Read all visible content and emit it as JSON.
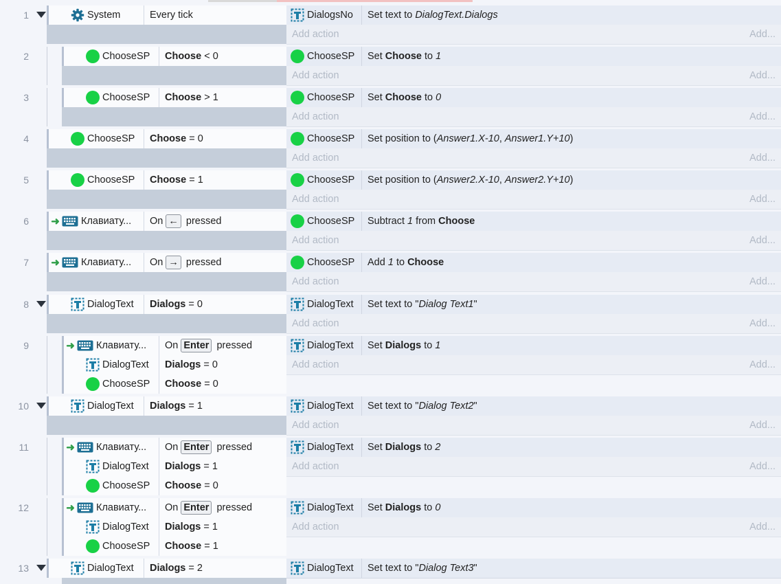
{
  "labels": {
    "add_action": "Add action",
    "add": "Add...",
    "on": "On",
    "pressed": "pressed"
  },
  "colors": {
    "sprite_dot": "#18d146",
    "text_icon": "#1d7ea6",
    "keyboard_icon": "#1d6f94",
    "arrow": "#2e9e48"
  },
  "events": [
    {
      "num": "1",
      "collapse": true,
      "conditions": [
        {
          "icon": "gear-icon",
          "object": "System",
          "parts": [
            {
              "t": "Every tick",
              "s": "n"
            }
          ]
        }
      ],
      "actions": [
        {
          "icon": "text-icon",
          "object": "DialogsNo",
          "parts": [
            {
              "t": "Set text to ",
              "s": "n"
            },
            {
              "t": "DialogText.Dialogs",
              "s": "i"
            }
          ]
        }
      ],
      "add_row": true
    },
    {
      "num": "2",
      "sub": true,
      "conditions": [
        {
          "icon": "sprite-dot-icon",
          "object": "ChooseSP",
          "parts": [
            {
              "t": "Choose",
              "s": "b"
            },
            {
              "t": " < 0",
              "s": "n"
            }
          ]
        }
      ],
      "actions": [
        {
          "icon": "sprite-dot-icon",
          "object": "ChooseSP",
          "parts": [
            {
              "t": "Set ",
              "s": "n"
            },
            {
              "t": "Choose",
              "s": "b"
            },
            {
              "t": " to ",
              "s": "n"
            },
            {
              "t": "1",
              "s": "i"
            }
          ]
        }
      ],
      "add_row": true
    },
    {
      "num": "3",
      "sub": true,
      "conditions": [
        {
          "icon": "sprite-dot-icon",
          "object": "ChooseSP",
          "parts": [
            {
              "t": "Choose",
              "s": "b"
            },
            {
              "t": " > 1",
              "s": "n"
            }
          ]
        }
      ],
      "actions": [
        {
          "icon": "sprite-dot-icon",
          "object": "ChooseSP",
          "parts": [
            {
              "t": "Set ",
              "s": "n"
            },
            {
              "t": "Choose",
              "s": "b"
            },
            {
              "t": " to ",
              "s": "n"
            },
            {
              "t": "0",
              "s": "i"
            }
          ]
        }
      ],
      "add_row": true
    },
    {
      "num": "4",
      "conditions": [
        {
          "icon": "sprite-dot-icon",
          "object": "ChooseSP",
          "parts": [
            {
              "t": "Choose",
              "s": "b"
            },
            {
              "t": " = 0",
              "s": "n"
            }
          ]
        }
      ],
      "actions": [
        {
          "icon": "sprite-dot-icon",
          "object": "ChooseSP",
          "parts": [
            {
              "t": "Set position to (",
              "s": "n"
            },
            {
              "t": "Answer1.X-10",
              "s": "i"
            },
            {
              "t": ", ",
              "s": "n"
            },
            {
              "t": "Answer1.Y+10",
              "s": "i"
            },
            {
              "t": ")",
              "s": "n"
            }
          ]
        }
      ],
      "add_row": true
    },
    {
      "num": "5",
      "conditions": [
        {
          "icon": "sprite-dot-icon",
          "object": "ChooseSP",
          "parts": [
            {
              "t": "Choose",
              "s": "b"
            },
            {
              "t": " = 1",
              "s": "n"
            }
          ]
        }
      ],
      "actions": [
        {
          "icon": "sprite-dot-icon",
          "object": "ChooseSP",
          "parts": [
            {
              "t": "Set position to (",
              "s": "n"
            },
            {
              "t": "Answer2.X-10",
              "s": "i"
            },
            {
              "t": ", ",
              "s": "n"
            },
            {
              "t": "Answer2.Y+10",
              "s": "i"
            },
            {
              "t": ")",
              "s": "n"
            }
          ]
        }
      ],
      "add_row": true
    },
    {
      "num": "6",
      "conditions": [
        {
          "trigger": true,
          "icon": "keyboard-icon",
          "object": "Клавиату...",
          "parts": [
            {
              "t": "On ",
              "s": "n"
            },
            {
              "t": "←",
              "s": "k"
            },
            {
              "t": " pressed",
              "s": "n"
            }
          ]
        }
      ],
      "actions": [
        {
          "icon": "sprite-dot-icon",
          "object": "ChooseSP",
          "parts": [
            {
              "t": "Subtract ",
              "s": "n"
            },
            {
              "t": "1",
              "s": "i"
            },
            {
              "t": " from ",
              "s": "n"
            },
            {
              "t": "Choose",
              "s": "b"
            }
          ]
        }
      ],
      "add_row": true
    },
    {
      "num": "7",
      "conditions": [
        {
          "trigger": true,
          "icon": "keyboard-icon",
          "object": "Клавиату...",
          "parts": [
            {
              "t": "On ",
              "s": "n"
            },
            {
              "t": "→",
              "s": "k"
            },
            {
              "t": " pressed",
              "s": "n"
            }
          ]
        }
      ],
      "actions": [
        {
          "icon": "sprite-dot-icon",
          "object": "ChooseSP",
          "parts": [
            {
              "t": "Add ",
              "s": "n"
            },
            {
              "t": "1",
              "s": "i"
            },
            {
              "t": " to ",
              "s": "n"
            },
            {
              "t": "Choose",
              "s": "b"
            }
          ]
        }
      ],
      "add_row": true
    },
    {
      "num": "8",
      "collapse": true,
      "conditions": [
        {
          "icon": "text-icon",
          "object": "DialogText",
          "parts": [
            {
              "t": "Dialogs",
              "s": "b"
            },
            {
              "t": " = 0",
              "s": "n"
            }
          ]
        }
      ],
      "actions": [
        {
          "icon": "text-icon",
          "object": "DialogText",
          "parts": [
            {
              "t": "Set text to \"",
              "s": "n"
            },
            {
              "t": "Dialog Text1",
              "s": "i"
            },
            {
              "t": "\"",
              "s": "n"
            }
          ]
        }
      ],
      "add_row": true
    },
    {
      "num": "9",
      "sub": true,
      "conditions": [
        {
          "trigger": true,
          "icon": "keyboard-icon",
          "object": "Клавиату...",
          "parts": [
            {
              "t": "On ",
              "s": "n"
            },
            {
              "t": "Enter",
              "s": "k"
            },
            {
              "t": " pressed",
              "s": "n"
            }
          ]
        },
        {
          "icon": "text-icon",
          "object": "DialogText",
          "parts": [
            {
              "t": "Dialogs",
              "s": "b"
            },
            {
              "t": " = 0",
              "s": "n"
            }
          ]
        },
        {
          "icon": "sprite-dot-icon",
          "object": "ChooseSP",
          "parts": [
            {
              "t": "Choose",
              "s": "b"
            },
            {
              "t": " = 0",
              "s": "n"
            }
          ]
        }
      ],
      "actions": [
        {
          "icon": "text-icon",
          "object": "DialogText",
          "parts": [
            {
              "t": "Set ",
              "s": "n"
            },
            {
              "t": "Dialogs",
              "s": "b"
            },
            {
              "t": " to ",
              "s": "n"
            },
            {
              "t": "1",
              "s": "i"
            }
          ]
        }
      ],
      "add_row": true
    },
    {
      "num": "10",
      "collapse": true,
      "conditions": [
        {
          "icon": "text-icon",
          "object": "DialogText",
          "parts": [
            {
              "t": "Dialogs",
              "s": "b"
            },
            {
              "t": " = 1",
              "s": "n"
            }
          ]
        }
      ],
      "actions": [
        {
          "icon": "text-icon",
          "object": "DialogText",
          "parts": [
            {
              "t": "Set text to \"",
              "s": "n"
            },
            {
              "t": "Dialog Text2",
              "s": "i"
            },
            {
              "t": "\"",
              "s": "n"
            }
          ]
        }
      ],
      "add_row": true
    },
    {
      "num": "11",
      "sub": true,
      "conditions": [
        {
          "trigger": true,
          "icon": "keyboard-icon",
          "object": "Клавиату...",
          "parts": [
            {
              "t": "On ",
              "s": "n"
            },
            {
              "t": "Enter",
              "s": "k"
            },
            {
              "t": " pressed",
              "s": "n"
            }
          ]
        },
        {
          "icon": "text-icon",
          "object": "DialogText",
          "parts": [
            {
              "t": "Dialogs",
              "s": "b"
            },
            {
              "t": " = 1",
              "s": "n"
            }
          ]
        },
        {
          "icon": "sprite-dot-icon",
          "object": "ChooseSP",
          "parts": [
            {
              "t": "Choose",
              "s": "b"
            },
            {
              "t": " = 0",
              "s": "n"
            }
          ]
        }
      ],
      "actions": [
        {
          "icon": "text-icon",
          "object": "DialogText",
          "parts": [
            {
              "t": "Set ",
              "s": "n"
            },
            {
              "t": "Dialogs",
              "s": "b"
            },
            {
              "t": " to ",
              "s": "n"
            },
            {
              "t": "2",
              "s": "i"
            }
          ]
        }
      ],
      "add_row": true
    },
    {
      "num": "12",
      "sub": true,
      "conditions": [
        {
          "trigger": true,
          "icon": "keyboard-icon",
          "object": "Клавиату...",
          "parts": [
            {
              "t": "On ",
              "s": "n"
            },
            {
              "t": "Enter",
              "s": "k"
            },
            {
              "t": " pressed",
              "s": "n"
            }
          ]
        },
        {
          "icon": "text-icon",
          "object": "DialogText",
          "parts": [
            {
              "t": "Dialogs",
              "s": "b"
            },
            {
              "t": " = 1",
              "s": "n"
            }
          ]
        },
        {
          "icon": "sprite-dot-icon",
          "object": "ChooseSP",
          "parts": [
            {
              "t": "Choose",
              "s": "b"
            },
            {
              "t": " = 1",
              "s": "n"
            }
          ]
        }
      ],
      "actions": [
        {
          "icon": "text-icon",
          "object": "DialogText",
          "parts": [
            {
              "t": "Set ",
              "s": "n"
            },
            {
              "t": "Dialogs",
              "s": "b"
            },
            {
              "t": " to ",
              "s": "n"
            },
            {
              "t": "0",
              "s": "i"
            }
          ]
        }
      ],
      "add_row": true
    },
    {
      "num": "13",
      "collapse": true,
      "conditions": [
        {
          "icon": "text-icon",
          "object": "DialogText",
          "parts": [
            {
              "t": "Dialogs",
              "s": "b"
            },
            {
              "t": " = 2",
              "s": "n"
            }
          ]
        }
      ],
      "actions": [
        {
          "icon": "text-icon",
          "object": "DialogText",
          "parts": [
            {
              "t": "Set text to \"",
              "s": "n"
            },
            {
              "t": "Dialog Text3",
              "s": "i"
            },
            {
              "t": "\"",
              "s": "n"
            }
          ]
        }
      ],
      "add_row": false
    }
  ]
}
